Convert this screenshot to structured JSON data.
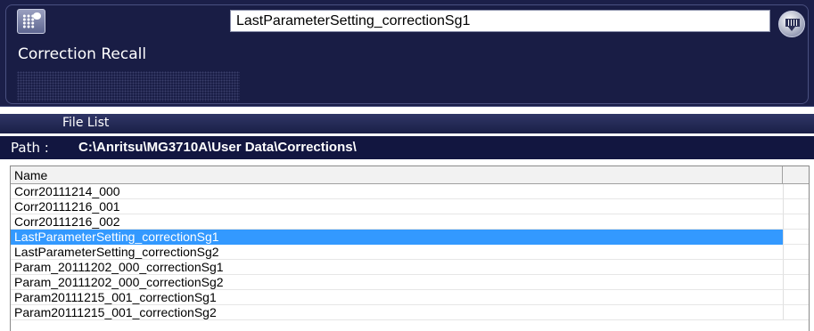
{
  "header": {
    "filename": "LastParameterSetting_correctionSg1",
    "title": "Correction Recall",
    "menu_icon": "menu-grid-icon",
    "keyboard_icon": "keyboard-icon"
  },
  "file_list": {
    "title": "File List",
    "path_label": "Path :",
    "path": "C:\\Anritsu\\MG3710A\\User Data\\Corrections\\",
    "column_name": "Name",
    "rows": [
      "Corr20111214_000",
      "Corr20111216_001",
      "Corr20111216_002",
      "LastParameterSetting_correctionSg1",
      "LastParameterSetting_correctionSg2",
      "Param_20111202_000_correctionSg1",
      "Param_20111202_000_correctionSg2",
      "Param20111215_001_correctionSg1",
      "Param20111215_001_correctionSg2"
    ],
    "selected_row": "LastParameterSetting_correctionSg1"
  },
  "colors": {
    "panel": "#1b1f49",
    "selection": "#3399ff"
  }
}
